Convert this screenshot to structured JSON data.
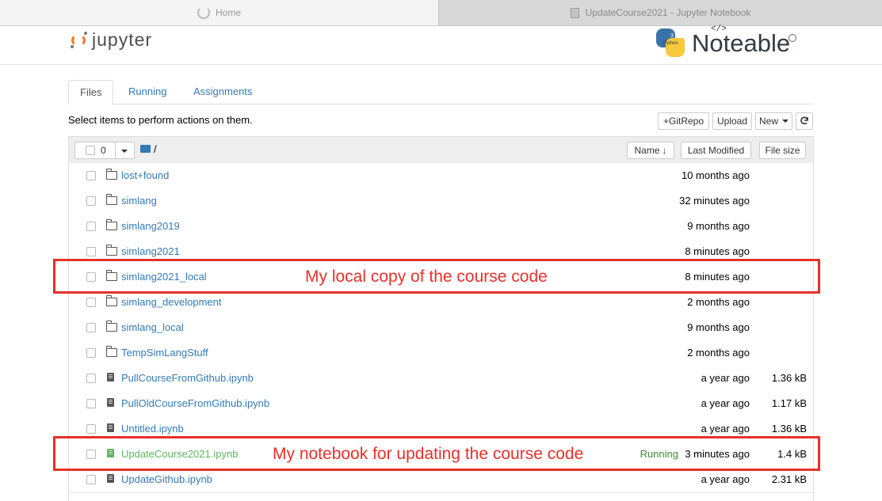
{
  "browser": {
    "tabs": [
      {
        "label": "Home"
      },
      {
        "label": "UpdateCourse2021 - Jupyter Notebook"
      }
    ]
  },
  "header": {
    "logo_text": "jupyter",
    "noteable_text": "Noteable",
    "python_label": "Python",
    "python_version": "3",
    "code_symbol": "</>"
  },
  "nav": {
    "tabs": [
      "Files",
      "Running",
      "Assignments"
    ]
  },
  "toolbar": {
    "select_text": "Select items to perform actions on them.",
    "gitrepo_label": "+GitRepo",
    "upload_label": "Upload",
    "new_label": "New",
    "refresh_icon": "refresh-icon"
  },
  "list_header": {
    "selected_count": "0",
    "path": "/",
    "name_label": "Name",
    "last_modified_label": "Last Modified",
    "file_size_label": "File size"
  },
  "files": [
    {
      "name": "lost+found",
      "type": "folder",
      "modified": "10 months ago",
      "size": ""
    },
    {
      "name": "simlang",
      "type": "folder",
      "modified": "32 minutes ago",
      "size": ""
    },
    {
      "name": "simlang2019",
      "type": "folder",
      "modified": "9 months ago",
      "size": ""
    },
    {
      "name": "simlang2021",
      "type": "folder",
      "modified": "8 minutes ago",
      "size": ""
    },
    {
      "name": "simlang2021_local",
      "type": "folder",
      "modified": "8 minutes ago",
      "size": ""
    },
    {
      "name": "simlang_development",
      "type": "folder",
      "modified": "2 months ago",
      "size": ""
    },
    {
      "name": "simlang_local",
      "type": "folder",
      "modified": "9 months ago",
      "size": ""
    },
    {
      "name": "TempSimLangStuff",
      "type": "folder",
      "modified": "2 months ago",
      "size": ""
    },
    {
      "name": "PullCourseFromGithub.ipynb",
      "type": "notebook",
      "modified": "a year ago",
      "size": "1.36 kB"
    },
    {
      "name": "PullOldCourseFromGithub.ipynb",
      "type": "notebook",
      "modified": "a year ago",
      "size": "1.17 kB"
    },
    {
      "name": "Untitled.ipynb",
      "type": "notebook",
      "modified": "a year ago",
      "size": "1.36 kB"
    },
    {
      "name": "UpdateCourse2021.ipynb",
      "type": "notebook",
      "modified": "3 minutes ago",
      "size": "1.4 kB",
      "running": "Running"
    },
    {
      "name": "UpdateGithub.ipynb",
      "type": "notebook",
      "modified": "a year ago",
      "size": "2.31 kB"
    }
  ],
  "annotations": {
    "local_copy": "My local copy of the course code",
    "notebook": "My notebook for updating the course code",
    "color": "#e8302a"
  }
}
